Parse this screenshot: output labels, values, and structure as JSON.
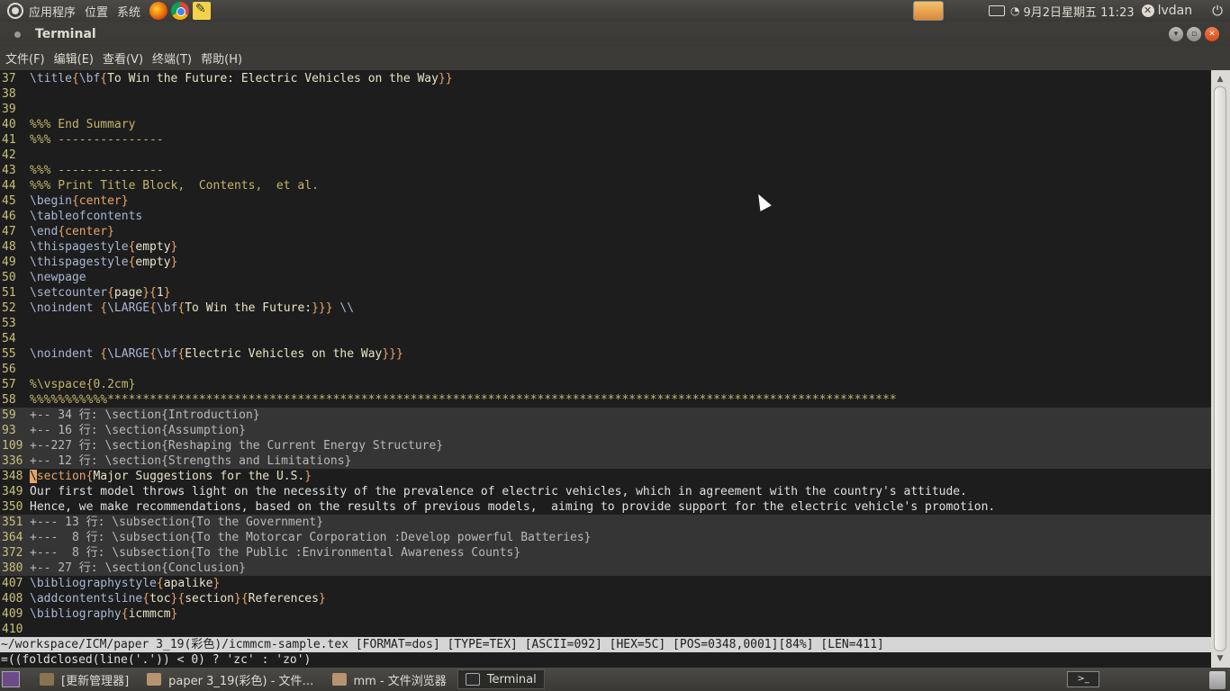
{
  "top_panel": {
    "menus": [
      "应用程序",
      "位置",
      "系统"
    ],
    "clock": "9月2日星期五 11:23",
    "username": "lvdan"
  },
  "window": {
    "title": "Terminal"
  },
  "menubar": [
    "文件(F)",
    "编辑(E)",
    "查看(V)",
    "终端(T)",
    "帮助(H)"
  ],
  "lines": [
    {
      "n": "37",
      "fold": false,
      "segs": [
        [
          "c-cmd",
          "\\title"
        ],
        [
          "c-brace",
          "{"
        ],
        [
          "c-cmd",
          "\\bf"
        ],
        [
          "c-brace",
          "{"
        ],
        [
          "c-arg",
          "To Win the Future: Electric Vehicles on the Way"
        ],
        [
          "c-brace",
          "}}"
        ]
      ]
    },
    {
      "n": "38",
      "fold": false,
      "segs": []
    },
    {
      "n": "39",
      "fold": false,
      "segs": []
    },
    {
      "n": "40",
      "fold": false,
      "segs": [
        [
          "c-comment",
          "%%% End Summary"
        ]
      ]
    },
    {
      "n": "41",
      "fold": false,
      "segs": [
        [
          "c-comment",
          "%%% ---------------"
        ]
      ]
    },
    {
      "n": "42",
      "fold": false,
      "segs": []
    },
    {
      "n": "43",
      "fold": false,
      "segs": [
        [
          "c-comment",
          "%%% ---------------"
        ]
      ]
    },
    {
      "n": "44",
      "fold": false,
      "segs": [
        [
          "c-comment",
          "%%% Print Title Block,  Contents,  et al."
        ]
      ]
    },
    {
      "n": "45",
      "fold": false,
      "segs": [
        [
          "c-cmd",
          "\\begin"
        ],
        [
          "c-brace",
          "{"
        ],
        [
          "c-brace",
          "center"
        ],
        [
          "c-brace",
          "}"
        ]
      ]
    },
    {
      "n": "46",
      "fold": false,
      "segs": [
        [
          "c-cmd",
          "\\tableofcontents"
        ]
      ]
    },
    {
      "n": "47",
      "fold": false,
      "segs": [
        [
          "c-cmd",
          "\\end"
        ],
        [
          "c-brace",
          "{"
        ],
        [
          "c-brace",
          "center"
        ],
        [
          "c-brace",
          "}"
        ]
      ]
    },
    {
      "n": "48",
      "fold": false,
      "segs": [
        [
          "c-cmd",
          "\\thispagestyle"
        ],
        [
          "c-brace",
          "{"
        ],
        [
          "c-arg",
          "empty"
        ],
        [
          "c-brace",
          "}"
        ]
      ]
    },
    {
      "n": "49",
      "fold": false,
      "segs": [
        [
          "c-cmd",
          "\\thispagestyle"
        ],
        [
          "c-brace",
          "{"
        ],
        [
          "c-arg",
          "empty"
        ],
        [
          "c-brace",
          "}"
        ]
      ]
    },
    {
      "n": "50",
      "fold": false,
      "segs": [
        [
          "c-cmd",
          "\\newpage"
        ]
      ]
    },
    {
      "n": "51",
      "fold": false,
      "segs": [
        [
          "c-cmd",
          "\\setcounter"
        ],
        [
          "c-brace",
          "{"
        ],
        [
          "c-arg",
          "page"
        ],
        [
          "c-brace",
          "}{"
        ],
        [
          "c-arg",
          "1"
        ],
        [
          "c-brace",
          "}"
        ]
      ]
    },
    {
      "n": "52",
      "fold": false,
      "segs": [
        [
          "c-cmd",
          "\\noindent "
        ],
        [
          "c-brace",
          "{"
        ],
        [
          "c-cmd",
          "\\LARGE"
        ],
        [
          "c-brace",
          "{"
        ],
        [
          "c-cmd",
          "\\bf"
        ],
        [
          "c-brace",
          "{"
        ],
        [
          "c-arg",
          "To Win the Future:"
        ],
        [
          "c-brace",
          "}}}"
        ],
        [
          "c-arg",
          " "
        ],
        [
          "c-cmd",
          "\\\\"
        ]
      ]
    },
    {
      "n": "53",
      "fold": false,
      "segs": []
    },
    {
      "n": "54",
      "fold": false,
      "segs": []
    },
    {
      "n": "55",
      "fold": false,
      "segs": [
        [
          "c-cmd",
          "\\noindent "
        ],
        [
          "c-brace",
          "{"
        ],
        [
          "c-cmd",
          "\\LARGE"
        ],
        [
          "c-brace",
          "{"
        ],
        [
          "c-cmd",
          "\\bf"
        ],
        [
          "c-brace",
          "{"
        ],
        [
          "c-arg",
          "Electric Vehicles on the Way"
        ],
        [
          "c-brace",
          "}}}"
        ]
      ]
    },
    {
      "n": "56",
      "fold": false,
      "segs": []
    },
    {
      "n": "57",
      "fold": false,
      "segs": [
        [
          "c-comment",
          "%\\vspace{0.2cm}"
        ]
      ]
    },
    {
      "n": "58",
      "fold": false,
      "segs": [
        [
          "c-comment",
          "%%%%%%%%%%%****************************************************************************************************************"
        ]
      ]
    },
    {
      "n": "59",
      "fold": true,
      "segs": [
        [
          "c-fold",
          "+-- 34 行: \\section{Introduction}"
        ]
      ]
    },
    {
      "n": "93",
      "fold": true,
      "segs": [
        [
          "c-fold",
          "+-- 16 行: \\section{Assumption}"
        ]
      ]
    },
    {
      "n": "109",
      "fold": true,
      "segs": [
        [
          "c-fold",
          "+--227 行: \\section{Reshaping the Current Energy Structure}"
        ]
      ]
    },
    {
      "n": "336",
      "fold": true,
      "segs": [
        [
          "c-fold",
          "+-- 12 行: \\section{Strengths and Limitations}"
        ]
      ]
    },
    {
      "n": "348",
      "fold": false,
      "segs": [
        [
          "cursor-block",
          "\\"
        ],
        [
          "c-brace",
          "section"
        ],
        [
          "c-brace",
          "{"
        ],
        [
          "c-arg",
          "Major Suggestions for the U.S."
        ],
        [
          "c-brace",
          "}"
        ]
      ]
    },
    {
      "n": "349",
      "fold": false,
      "segs": [
        [
          "c-text",
          "Our first model throws light on the necessity of the prevalence of electric vehicles, which in agreement with the country's attitude."
        ]
      ]
    },
    {
      "n": "350",
      "fold": false,
      "segs": [
        [
          "c-text",
          "Hence, we make recommendations, based on the results of previous models,  aiming to provide support for the electric vehicle's promotion."
        ]
      ]
    },
    {
      "n": "351",
      "fold": true,
      "segs": [
        [
          "c-fold",
          "+--- 13 行: \\subsection{To the Government}"
        ]
      ]
    },
    {
      "n": "364",
      "fold": true,
      "segs": [
        [
          "c-fold",
          "+---  8 行: \\subsection{To the Motorcar Corporation :Develop powerful Batteries}"
        ]
      ]
    },
    {
      "n": "372",
      "fold": true,
      "segs": [
        [
          "c-fold",
          "+---  8 行: \\subsection{To the Public :Environmental Awareness Counts}"
        ]
      ]
    },
    {
      "n": "380",
      "fold": true,
      "segs": [
        [
          "c-fold",
          "+-- 27 行: \\section{Conclusion}"
        ]
      ]
    },
    {
      "n": "407",
      "fold": false,
      "segs": [
        [
          "c-cmd",
          "\\bibliographystyle"
        ],
        [
          "c-brace",
          "{"
        ],
        [
          "c-arg",
          "apalike"
        ],
        [
          "c-brace",
          "}"
        ]
      ]
    },
    {
      "n": "408",
      "fold": false,
      "segs": [
        [
          "c-cmd",
          "\\addcontentsline"
        ],
        [
          "c-brace",
          "{"
        ],
        [
          "c-arg",
          "toc"
        ],
        [
          "c-brace",
          "}{"
        ],
        [
          "c-arg",
          "section"
        ],
        [
          "c-brace",
          "}{"
        ],
        [
          "c-arg",
          "References"
        ],
        [
          "c-brace",
          "}"
        ]
      ]
    },
    {
      "n": "409",
      "fold": false,
      "segs": [
        [
          "c-cmd",
          "\\bibliography"
        ],
        [
          "c-brace",
          "{"
        ],
        [
          "c-arg",
          "icmmcm"
        ],
        [
          "c-brace",
          "}"
        ]
      ]
    },
    {
      "n": "410",
      "fold": false,
      "segs": []
    }
  ],
  "statusline": "~/workspace/ICM/paper 3_19(彩色)/icmmcm-sample.tex [FORMAT=dos] [TYPE=TEX] [ASCII=092] [HEX=5C] [POS=0348,0001][84%] [LEN=411]",
  "cmdline": "=((foldclosed(line('.')) < 0) ? 'zc' : 'zo')",
  "taskbar": {
    "tasks": [
      {
        "label": "[更新管理器]",
        "icon": "update-manager-icon"
      },
      {
        "label": "paper 3_19(彩色) - 文件…",
        "icon": "folder-icon"
      },
      {
        "label": "mm - 文件浏览器",
        "icon": "folder-icon"
      },
      {
        "label": "Terminal",
        "icon": "terminal-icon"
      }
    ]
  }
}
